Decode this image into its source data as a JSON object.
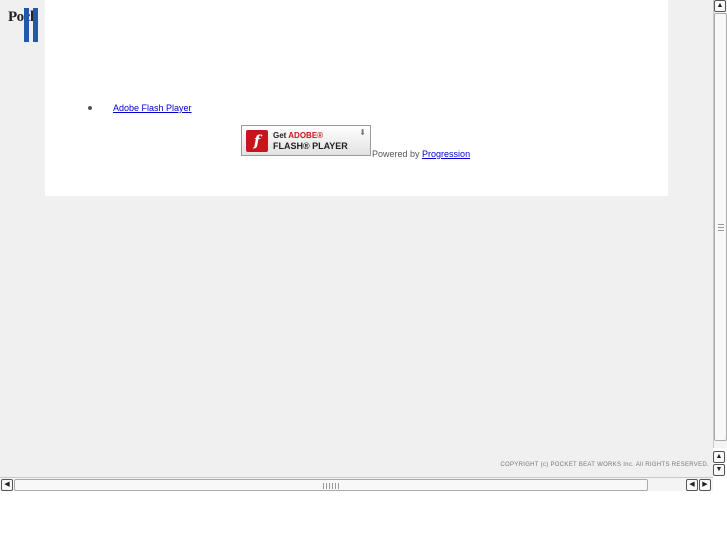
{
  "logo": {
    "text": "Pock"
  },
  "content": {
    "list_items": [
      {
        "label": "Adobe Flash Player"
      }
    ],
    "flash_badge": {
      "get": "Get",
      "adobe": "ADOBE®",
      "product": "FLASH® PLAYER"
    },
    "powered_by": {
      "prefix": "Powered by",
      "link": "Progression"
    }
  },
  "footer": {
    "copyright": "COPYRIGHT (c) POCKET BEAT WORKS Inc. All RIGHTS RESERVED."
  },
  "icons": {
    "scroll_up": "▲",
    "scroll_down": "▼",
    "scroll_left": "◀",
    "scroll_right": "▶",
    "flash_logo": "f",
    "download": "⬇"
  },
  "colors": {
    "link": "#0000cc",
    "flash_red": "#c8151d",
    "logo_blue": "#1e5aa8"
  }
}
